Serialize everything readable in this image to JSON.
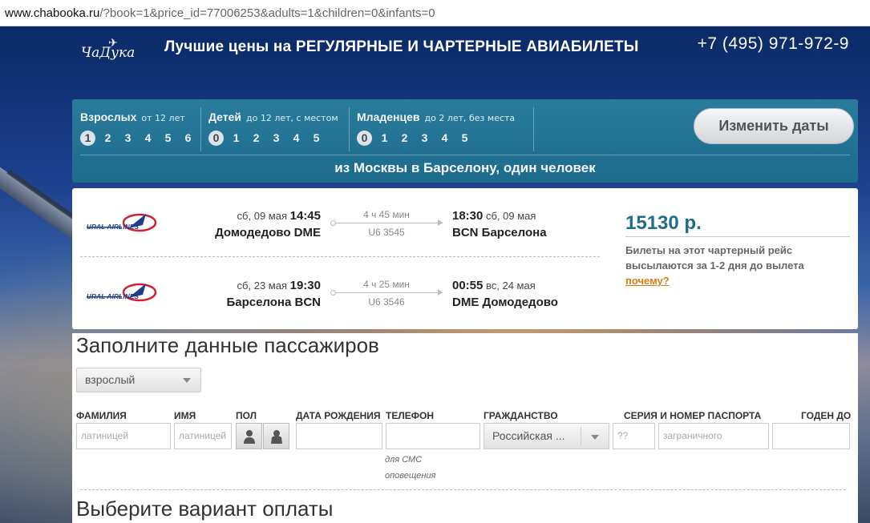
{
  "browser": {
    "url_domain": "www.chabooka.ru",
    "url_rest": "/?book=1&price_id=77006253&adults=1&children=0&infants=0"
  },
  "header": {
    "logo_text": "ЧаДука",
    "tagline": "Лучшие цены на РЕГУЛЯРНЫЕ И ЧАРТЕРНЫЕ АВИАБИЛЕТЫ",
    "phone": "+7 (495) 971-972-9"
  },
  "search": {
    "adults": {
      "title": "Взрослых",
      "sub": "от 12 лет",
      "options": [
        "1",
        "2",
        "3",
        "4",
        "5",
        "6"
      ],
      "selected": "1"
    },
    "children": {
      "title": "Детей",
      "sub": "до 12 лет, с местом",
      "options": [
        "0",
        "1",
        "2",
        "3",
        "4",
        "5"
      ],
      "selected": "0"
    },
    "infants": {
      "title": "Младенцев",
      "sub": "до 2 лет, без места",
      "options": [
        "0",
        "1",
        "2",
        "3",
        "4",
        "5"
      ],
      "selected": "0"
    },
    "change_dates_label": "Изменить даты",
    "route_text": "из Москвы в Барселону, один человек"
  },
  "flights": [
    {
      "airline": "URAL AIRLINES",
      "dep_date": "сб, 09 мая",
      "dep_time": "14:45",
      "dep_airport": "Домодедово DME",
      "duration": "4 ч 45 мин",
      "flight_no": "U6 3545",
      "arr_time": "18:30",
      "arr_date": "сб, 09 мая",
      "arr_airport": "BCN Барселона"
    },
    {
      "airline": "URAL AIRLINES",
      "dep_date": "сб, 23 мая",
      "dep_time": "19:30",
      "dep_airport": "Барселона BCN",
      "duration": "4 ч 25 мин",
      "flight_no": "U6 3546",
      "arr_time": "00:55",
      "arr_date": "вс, 24 мая",
      "arr_airport": "DME Домодедово"
    }
  ],
  "price": {
    "amount": "15130 р.",
    "note": "Билеты на этот чартерный рейс высылаются за 1-2 дня до вылета",
    "link": "почему?"
  },
  "passengers": {
    "title": "Заполните данные пассажиров",
    "type_select": "взрослый",
    "labels": {
      "surname": "ФАМИЛИЯ",
      "name": "ИМЯ",
      "sex": "ПОЛ",
      "birth": "ДАТА РОЖДЕНИЯ",
      "phone": "ТЕЛЕФОН",
      "citizenship": "ГРАЖДАНСТВО",
      "passport": "СЕРИЯ И НОМЕР ПАСПОРТА",
      "valid": "ГОДЕН ДО"
    },
    "placeholders": {
      "surname": "латиницей",
      "name": "латиницей",
      "series": "??",
      "passport": "заграничного"
    },
    "citizenship_value": "Российская ...",
    "phone_hint_1": "для СМС",
    "phone_hint_2": "оповещения"
  },
  "payment": {
    "title": "Выберите вариант оплаты"
  }
}
